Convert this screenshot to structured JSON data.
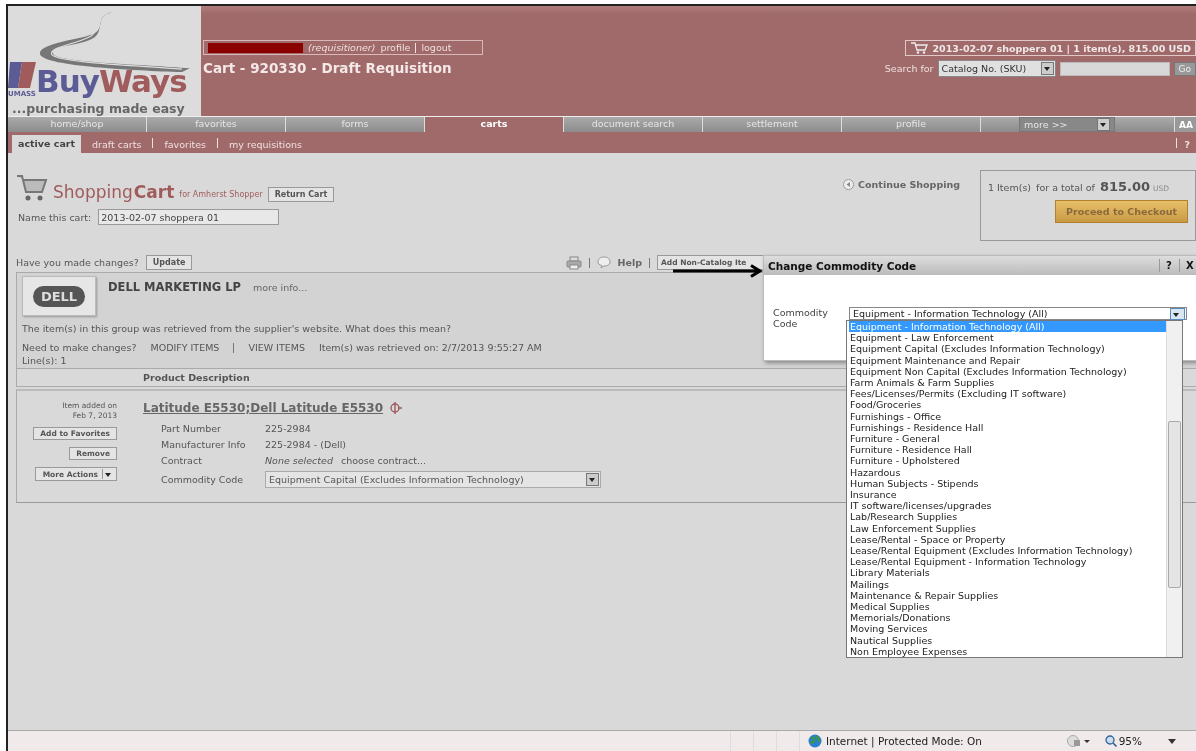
{
  "header": {
    "logo": {
      "word_1": "Buy",
      "word_2": "Ways",
      "tag": "UMASS",
      "slogan": "...purchasing made easy"
    },
    "user_bar": {
      "role": "(requisitioner)",
      "links": [
        "profile",
        "logout"
      ]
    },
    "title": "Cart - 920330 - Draft Requisition",
    "cart_summary": "2013-02-07 shoppera 01 | 1 item(s), 815.00 USD",
    "search": {
      "label": "Search for",
      "type": "Catalog No. (SKU)",
      "button": "Go"
    }
  },
  "nav": {
    "tabs": [
      {
        "label": "home/shop",
        "selected": false
      },
      {
        "label": "favorites",
        "selected": false
      },
      {
        "label": "forms",
        "selected": false
      },
      {
        "label": "carts",
        "selected": true
      },
      {
        "label": "document search",
        "selected": false
      },
      {
        "label": "settlement",
        "selected": false
      },
      {
        "label": "profile",
        "selected": false
      }
    ],
    "more": "more >>",
    "font_size": "AA"
  },
  "subnav": {
    "tabs": [
      {
        "label": "active cart",
        "selected": true
      },
      {
        "label": "draft carts",
        "selected": false
      },
      {
        "label": "favorites",
        "selected": false
      },
      {
        "label": "my requisitions",
        "selected": false
      }
    ],
    "help": "?"
  },
  "cart": {
    "title_light": "Shopping",
    "title_bold": "Cart",
    "owner": "for Amherst Shopper",
    "return_button": "Return Cart",
    "name_label": "Name this cart:",
    "name_value": "2013-02-07 shoppera 01"
  },
  "summary": {
    "continue": "Continue Shopping",
    "count": "1 Item(s)",
    "total_label": "for a total of",
    "total": "815.00",
    "currency": "USD",
    "checkout": "Proceed to Checkout"
  },
  "changes": {
    "question": "Have you made changes?",
    "button": "Update"
  },
  "toolbar": {
    "help": "Help",
    "add_button": "Add Non-Catalog Ite"
  },
  "supplier": {
    "logo_text": "DELL",
    "name": "DELL MARKETING LP",
    "more": "more info...",
    "note": "The item(s) in this group was retrieved from the supplier's website. What does this mean?",
    "need": "Need to make changes?",
    "modify": "MODIFY ITEMS",
    "view": "VIEW ITEMS",
    "retrieved": "Item(s) was retrieved on: 2/7/2013 9:55:27 AM",
    "lines": "Line(s): 1"
  },
  "table": {
    "columns": [
      "Product Description"
    ]
  },
  "item": {
    "added_label": "Item added on",
    "added_date": "Feb 7, 2013",
    "buttons": [
      "Add to Favorites",
      "Remove"
    ],
    "more_actions": "More Actions",
    "title": "Latitude E5530;Dell Latitude E5530",
    "fields": [
      {
        "label": "Part Number",
        "value": "225-2984"
      },
      {
        "label": "Manufacturer Info",
        "value": "225-2984 - (Dell)"
      }
    ],
    "contract": {
      "label": "Contract",
      "value": "None selected",
      "link": "choose contract..."
    },
    "commodity": {
      "label": "Commodity Code",
      "value": "Equipment Capital (Excludes Information Technology)"
    }
  },
  "dialog": {
    "title": "Change Commodity Code",
    "help": "?",
    "close": "X",
    "label": "Commodity Code",
    "value": "Equipment - Information Technology (All)",
    "options": [
      {
        "label": "Equipment - Information Technology (All)",
        "selected": true
      },
      {
        "label": "Equipment - Law Enforcement",
        "selected": false
      },
      {
        "label": "Equipment Capital (Excludes Information Technology)",
        "selected": false
      },
      {
        "label": "Equipment Maintenance and Repair",
        "selected": false
      },
      {
        "label": "Equipment Non Capital (Excludes Information Technology)",
        "selected": false
      },
      {
        "label": "Farm Animals & Farm Supplies",
        "selected": false
      },
      {
        "label": "Fees/Licenses/Permits (Excluding IT software)",
        "selected": false
      },
      {
        "label": "Food/Groceries",
        "selected": false
      },
      {
        "label": "Furnishings - Office",
        "selected": false
      },
      {
        "label": "Furnishings - Residence Hall",
        "selected": false
      },
      {
        "label": "Furniture - General",
        "selected": false
      },
      {
        "label": "Furniture - Residence Hall",
        "selected": false
      },
      {
        "label": "Furniture - Upholstered",
        "selected": false
      },
      {
        "label": "Hazardous",
        "selected": false
      },
      {
        "label": "Human Subjects - Stipends",
        "selected": false
      },
      {
        "label": "Insurance",
        "selected": false
      },
      {
        "label": "IT software/licenses/upgrades",
        "selected": false
      },
      {
        "label": "Lab/Research Supplies",
        "selected": false
      },
      {
        "label": "Law Enforcement Supplies",
        "selected": false
      },
      {
        "label": "Lease/Rental - Space or Property",
        "selected": false
      },
      {
        "label": "Lease/Rental Equipment (Excludes Information Technology)",
        "selected": false
      },
      {
        "label": "Lease/Rental Equipment - Information Technology",
        "selected": false
      },
      {
        "label": "Library Materials",
        "selected": false
      },
      {
        "label": "Mailings",
        "selected": false
      },
      {
        "label": "Maintenance & Repair Supplies",
        "selected": false
      },
      {
        "label": "Medical Supplies",
        "selected": false
      },
      {
        "label": "Memorials/Donations",
        "selected": false
      },
      {
        "label": "Moving Services",
        "selected": false
      },
      {
        "label": "Nautical Supplies",
        "selected": false
      },
      {
        "label": "Non Employee Expenses",
        "selected": false
      }
    ]
  },
  "status_bar": {
    "zone": "Internet | Protected Mode: On",
    "zoom": "95%"
  }
}
